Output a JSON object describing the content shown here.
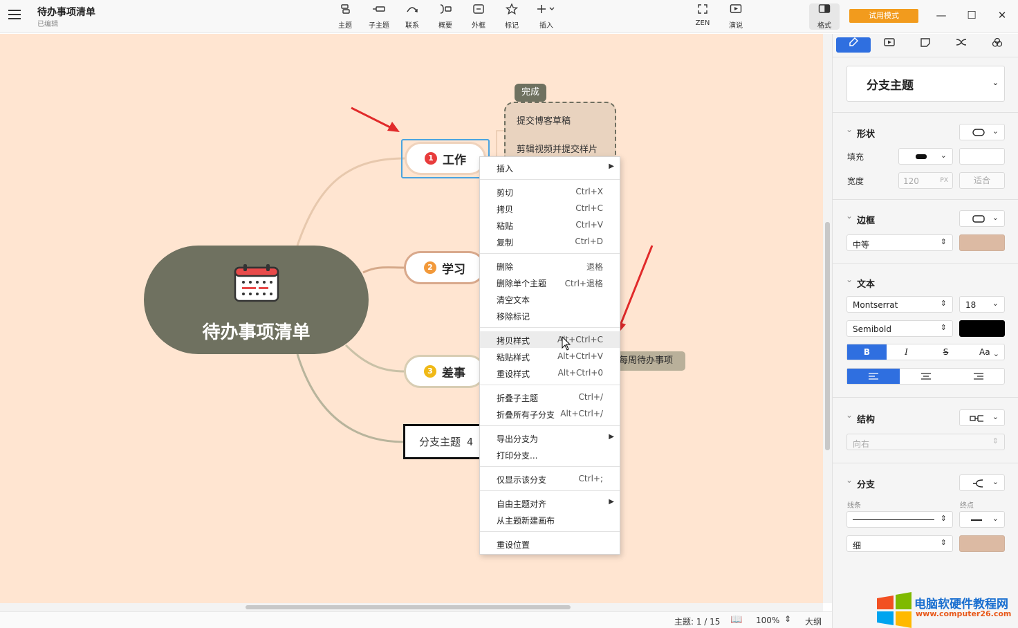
{
  "window": {
    "title": "待办事项清单",
    "subtitle": "已编辑",
    "trial_label": "试用模式",
    "controls": {
      "minimize": "—",
      "maximize": "☐",
      "close": "✕"
    }
  },
  "toolbar": {
    "items": [
      {
        "label": "主题",
        "icon": "topic-icon"
      },
      {
        "label": "子主题",
        "icon": "subtopic-icon"
      },
      {
        "label": "联系",
        "icon": "relationship-icon"
      },
      {
        "label": "概要",
        "icon": "summary-icon"
      },
      {
        "label": "外框",
        "icon": "boundary-icon"
      },
      {
        "label": "标记",
        "icon": "marker-icon"
      },
      {
        "label": "插入",
        "icon": "insert-icon"
      }
    ],
    "zen_label": "ZEN",
    "present_label": "演说",
    "format_label": "格式"
  },
  "map": {
    "central_topic": "待办事项清单",
    "topics": [
      {
        "num": "1",
        "label": "工作",
        "num_color": "#e83c3c"
      },
      {
        "num": "2",
        "label": "学习",
        "num_color": "#f2993a"
      },
      {
        "num": "3",
        "label": "差事",
        "num_color": "#f0b916"
      }
    ],
    "topic4_label": "分支主题 4",
    "boundary_label": "完成",
    "subtopics": [
      "提交博客草稿",
      "剪辑视频并提交样片"
    ],
    "summary_chip": "每周待办事项"
  },
  "context_menu": {
    "insert": "插入",
    "cut": {
      "label": "剪切",
      "shortcut": "Ctrl+X"
    },
    "copy": {
      "label": "拷贝",
      "shortcut": "Ctrl+C"
    },
    "paste": {
      "label": "粘贴",
      "shortcut": "Ctrl+V"
    },
    "duplicate": {
      "label": "复制",
      "shortcut": "Ctrl+D"
    },
    "delete": {
      "label": "删除",
      "shortcut": "退格"
    },
    "delete_single": {
      "label": "删除单个主题",
      "shortcut": "Ctrl+退格"
    },
    "clear_text": "清空文本",
    "remove_marker": "移除标记",
    "copy_style": {
      "label": "拷贝样式",
      "shortcut": "Alt+Ctrl+C"
    },
    "paste_style": {
      "label": "粘贴样式",
      "shortcut": "Alt+Ctrl+V"
    },
    "reset_style": {
      "label": "重设样式",
      "shortcut": "Alt+Ctrl+0"
    },
    "collapse_sub": {
      "label": "折叠子主题",
      "shortcut": "Ctrl+/"
    },
    "collapse_all": {
      "label": "折叠所有子分支",
      "shortcut": "Alt+Ctrl+/"
    },
    "export_branch": "导出分支为",
    "print_branch": "打印分支...",
    "show_only": {
      "label": "仅显示该分支",
      "shortcut": "Ctrl+;"
    },
    "free_align": "自由主题对齐",
    "new_sheet": "从主题新建画布",
    "reset_pos": "重设位置"
  },
  "status": {
    "topic_count": "主题: 1 / 15",
    "zoom": "100%",
    "outline": "大纲"
  },
  "panel": {
    "style_select": "分支主题",
    "shape": {
      "title": "形状",
      "fill_label": "填充",
      "width_label": "宽度",
      "width_placeholder": "120",
      "width_unit": "PX",
      "fit_label": "适合"
    },
    "border": {
      "title": "边框",
      "weight": "中等",
      "color": "#dcbaa3"
    },
    "text": {
      "title": "文本",
      "font": "Montserrat",
      "size": "18",
      "weight": "Semibold",
      "color": "#000000",
      "bold": "B",
      "italic": "I",
      "strike": "S",
      "case": "Aa"
    },
    "structure": {
      "title": "结构",
      "direction": "向右"
    },
    "branch": {
      "title": "分支",
      "line_label": "线条",
      "end_label": "终点",
      "thickness": "细",
      "color": "#dcbaa3"
    }
  },
  "watermark": {
    "line1": "电脑软硬件教程网",
    "line2": "www.computer26.com"
  },
  "colors": {
    "canvas": "#ffe5d1",
    "central": "#6f7160",
    "accent": "#2f6fe0",
    "trial": "#f29b1d",
    "arrow": "#e12a2a"
  }
}
